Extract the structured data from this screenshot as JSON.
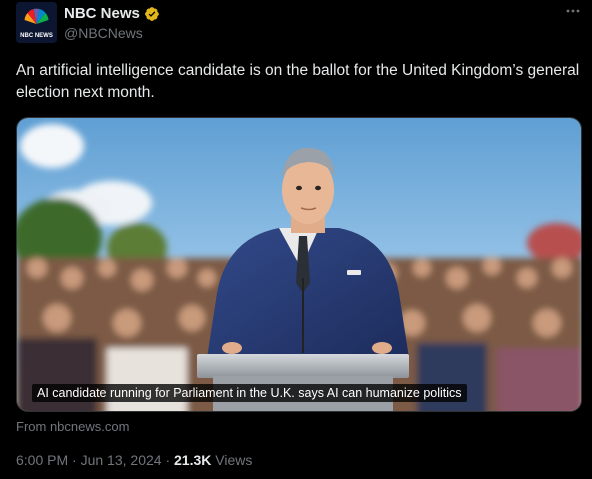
{
  "account": {
    "name": "NBC News",
    "handle": "@NBCNews",
    "avatar_text": "NBC NEWS",
    "verified_color": "#e2b719"
  },
  "tweet": {
    "text": "An artificial intelligence candidate is on the ballot for the United Kingdom’s general election next month.",
    "media_caption": "AI candidate running for Parliament in the U.K. says AI can humanize politics",
    "source": "From nbcnews.com",
    "time": "6:00 PM",
    "separator": "·",
    "date": "Jun 13, 2024",
    "views_count": "21.3K",
    "views_label": "Views"
  },
  "icons": {
    "more": "more-options-icon",
    "verified": "verified-badge-icon"
  }
}
